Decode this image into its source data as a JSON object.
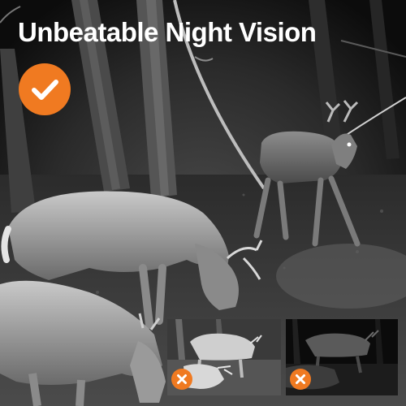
{
  "headline": "Unbeatable Night Vision",
  "accent_color": "#f07a21",
  "badges": {
    "main": "check-icon",
    "compare": "close-icon"
  }
}
